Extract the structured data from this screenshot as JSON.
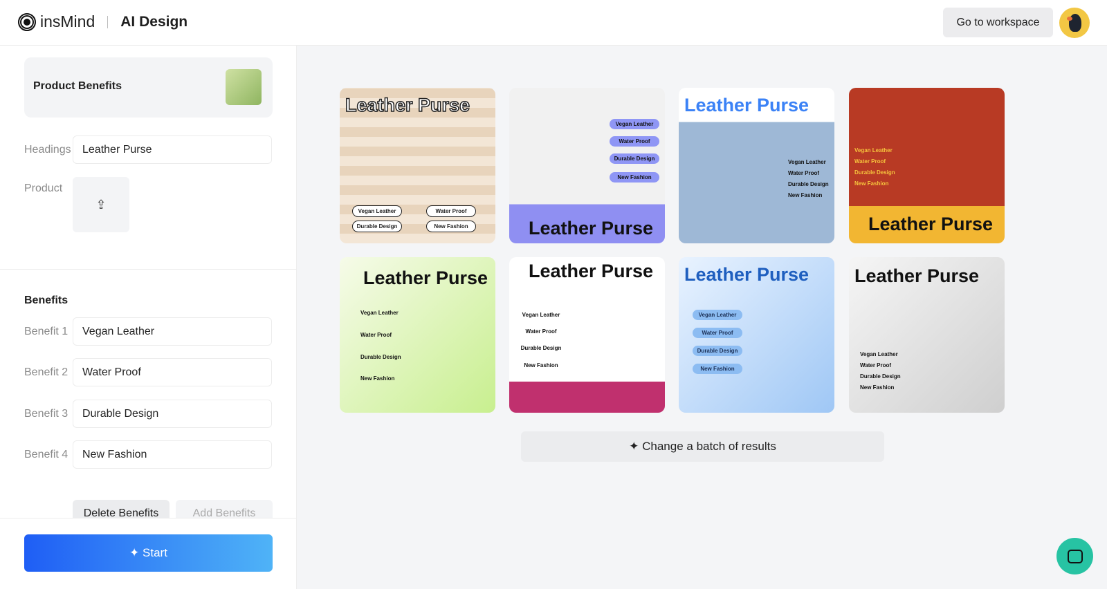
{
  "header": {
    "brand": "insMind",
    "app": "AI Design",
    "workspace": "Go to workspace"
  },
  "left": {
    "template": "Product Benefits",
    "headings_label": "Headings",
    "headings_value": "Leather Purse",
    "product_label": "Product",
    "benefits_title": "Benefits",
    "benefits": [
      {
        "label": "Benefit 1",
        "value": "Vegan Leather"
      },
      {
        "label": "Benefit 2",
        "value": "Water Proof"
      },
      {
        "label": "Benefit 3",
        "value": "Durable Design"
      },
      {
        "label": "Benefit 4",
        "value": "New Fashion"
      }
    ],
    "delete": "Delete Benefits",
    "add": "Add Benefits",
    "start": "Start"
  },
  "results": {
    "title": "Leather Purse",
    "benefits": [
      "Vegan Leather",
      "Water Proof",
      "Durable Design",
      "New Fashion"
    ],
    "change": "Change a batch of results"
  }
}
